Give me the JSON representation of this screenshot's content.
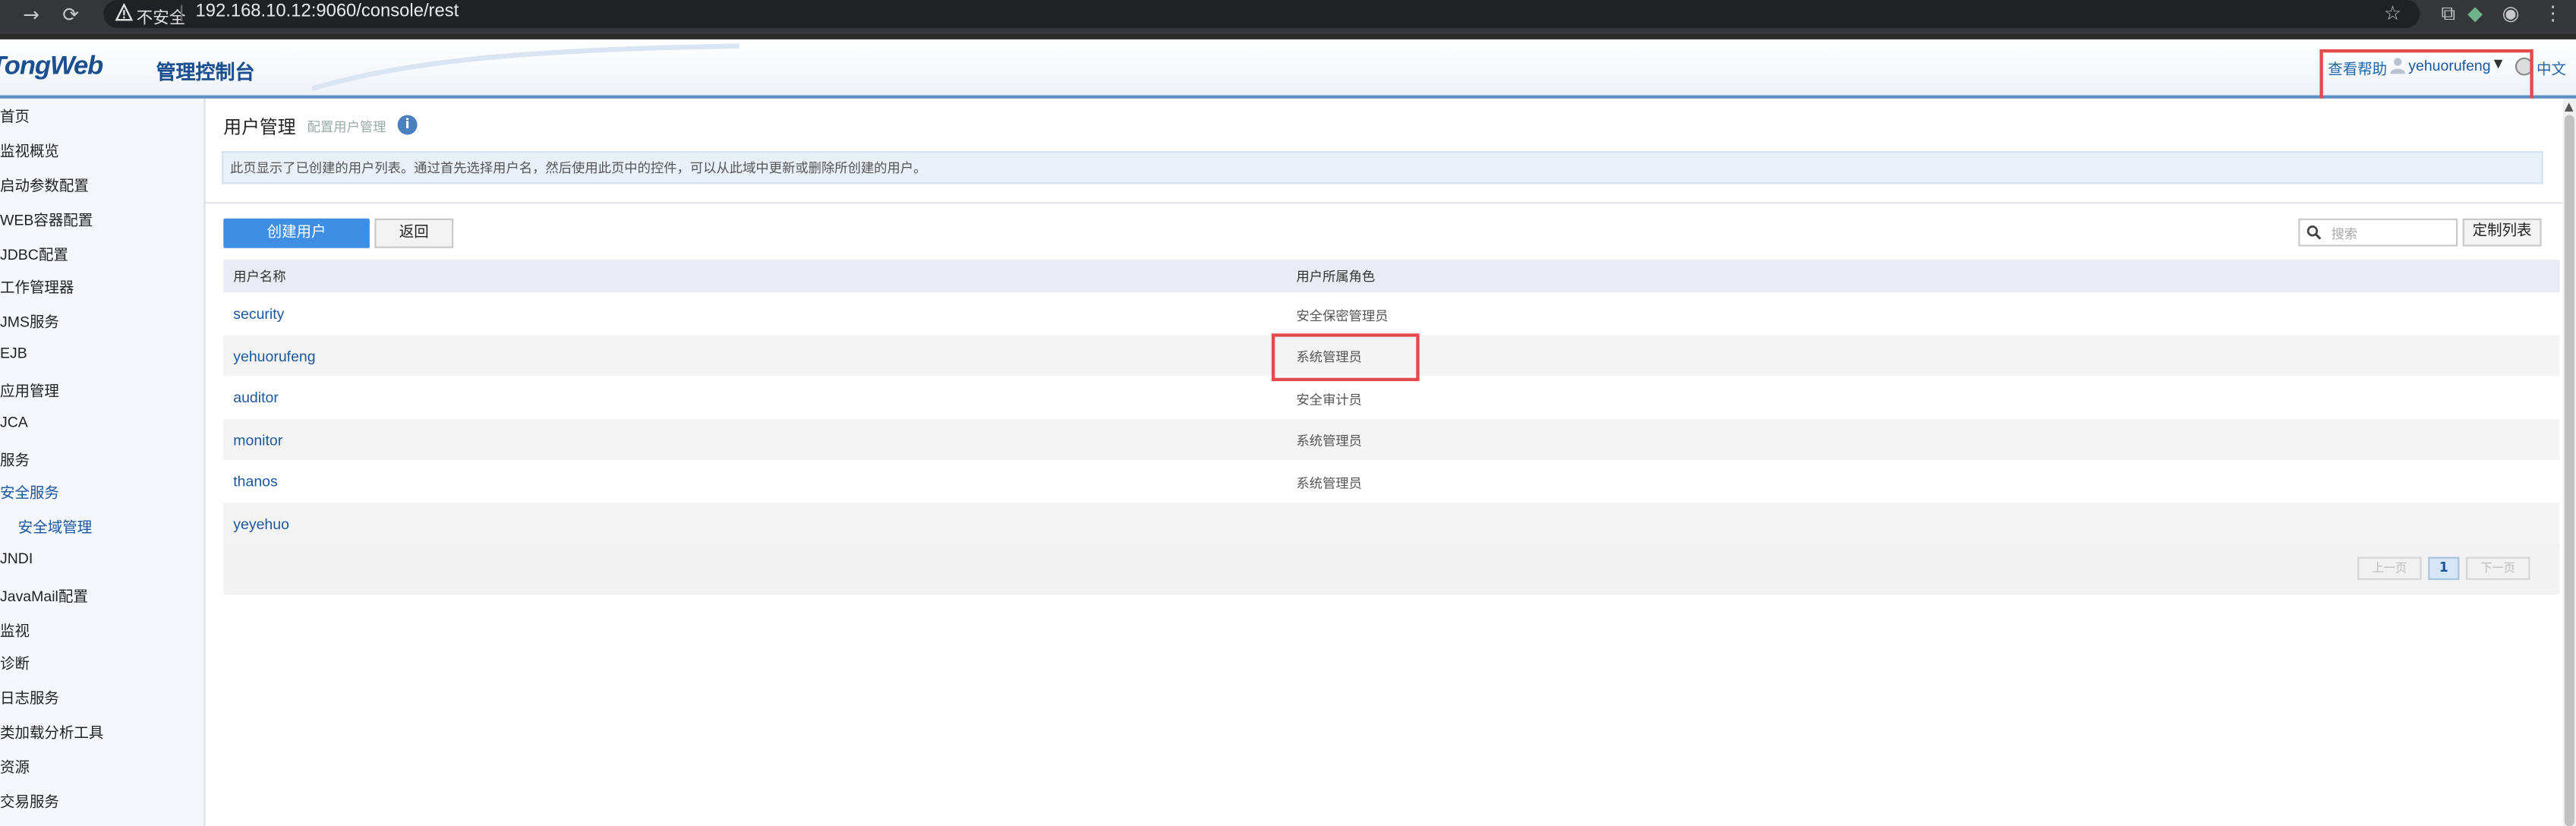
{
  "browser": {
    "security_label": "不安全",
    "url": "192.168.10.12:9060/console/rest"
  },
  "header": {
    "logo_main": "TongWeb",
    "logo_sub": "管理控制台",
    "help_link": "查看帮助",
    "username": "yehuorufeng",
    "language": "中文"
  },
  "sidebar": {
    "items": [
      {
        "label": "首页"
      },
      {
        "label": "监视概览"
      },
      {
        "label": "启动参数配置"
      },
      {
        "label": "WEB容器配置"
      },
      {
        "label": "JDBC配置"
      },
      {
        "label": "工作管理器"
      },
      {
        "label": "JMS服务"
      },
      {
        "label": "EJB"
      },
      {
        "label": "应用管理"
      },
      {
        "label": "JCA"
      },
      {
        "label": "服务"
      },
      {
        "label": "安全服务"
      },
      {
        "label": "安全域管理"
      },
      {
        "label": "JNDI"
      },
      {
        "label": "JavaMail配置"
      },
      {
        "label": "监视"
      },
      {
        "label": "诊断"
      },
      {
        "label": "日志服务"
      },
      {
        "label": "类加载分析工具"
      },
      {
        "label": "资源"
      },
      {
        "label": "交易服务"
      }
    ]
  },
  "main": {
    "title": "用户管理",
    "subtitle": "配置用户管理",
    "description": "此页显示了已创建的用户列表。通过首先选择用户名，然后使用此页中的控件，可以从此域中更新或删除所创建的用户。",
    "create_button": "创建用户",
    "back_button": "返回",
    "search_placeholder": "搜索",
    "customize_columns_button": "定制列表",
    "table": {
      "columns": [
        "用户名称",
        "用户所属角色"
      ],
      "rows": [
        {
          "user": "security",
          "role": "安全保密管理员"
        },
        {
          "user": "yehuorufeng",
          "role": "系统管理员"
        },
        {
          "user": "auditor",
          "role": "安全审计员"
        },
        {
          "user": "monitor",
          "role": "系统管理员"
        },
        {
          "user": "thanos",
          "role": "系统管理员"
        },
        {
          "user": "yeyehuo",
          "role": ""
        }
      ]
    },
    "pager": {
      "prev": "上一页",
      "current": "1",
      "next": "下一页"
    }
  },
  "colors": {
    "accent": "#3e8ee4",
    "link": "#1c57a0",
    "highlight_box": "#e24b4b"
  }
}
